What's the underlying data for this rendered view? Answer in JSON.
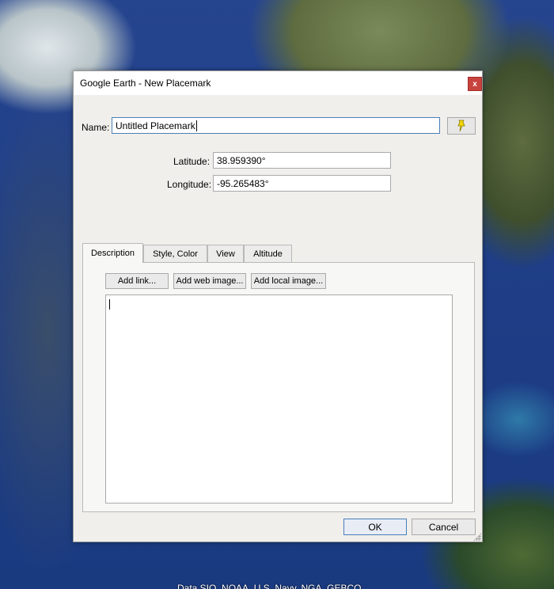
{
  "window": {
    "title": "Google Earth - New Placemark",
    "close_label": "x"
  },
  "form": {
    "name_label": "Name:",
    "name_value": "Untitled Placemark",
    "latitude_label": "Latitude:",
    "latitude_value": "38.959390°",
    "longitude_label": "Longitude:",
    "longitude_value": "-95.265483°"
  },
  "tabs": [
    {
      "label": "Description",
      "active": true
    },
    {
      "label": "Style, Color",
      "active": false
    },
    {
      "label": "View",
      "active": false
    },
    {
      "label": "Altitude",
      "active": false
    }
  ],
  "description": {
    "add_link_label": "Add link...",
    "add_web_image_label": "Add web image...",
    "add_local_image_label": "Add local image...",
    "text": ""
  },
  "buttons": {
    "ok_label": "OK",
    "cancel_label": "Cancel"
  },
  "map": {
    "attribution": "Data SIO, NOAA, U.S. Navy, NGA, GEBCO"
  },
  "icons": {
    "pin": "pushpin-icon",
    "pin_color": "#f2d600"
  }
}
